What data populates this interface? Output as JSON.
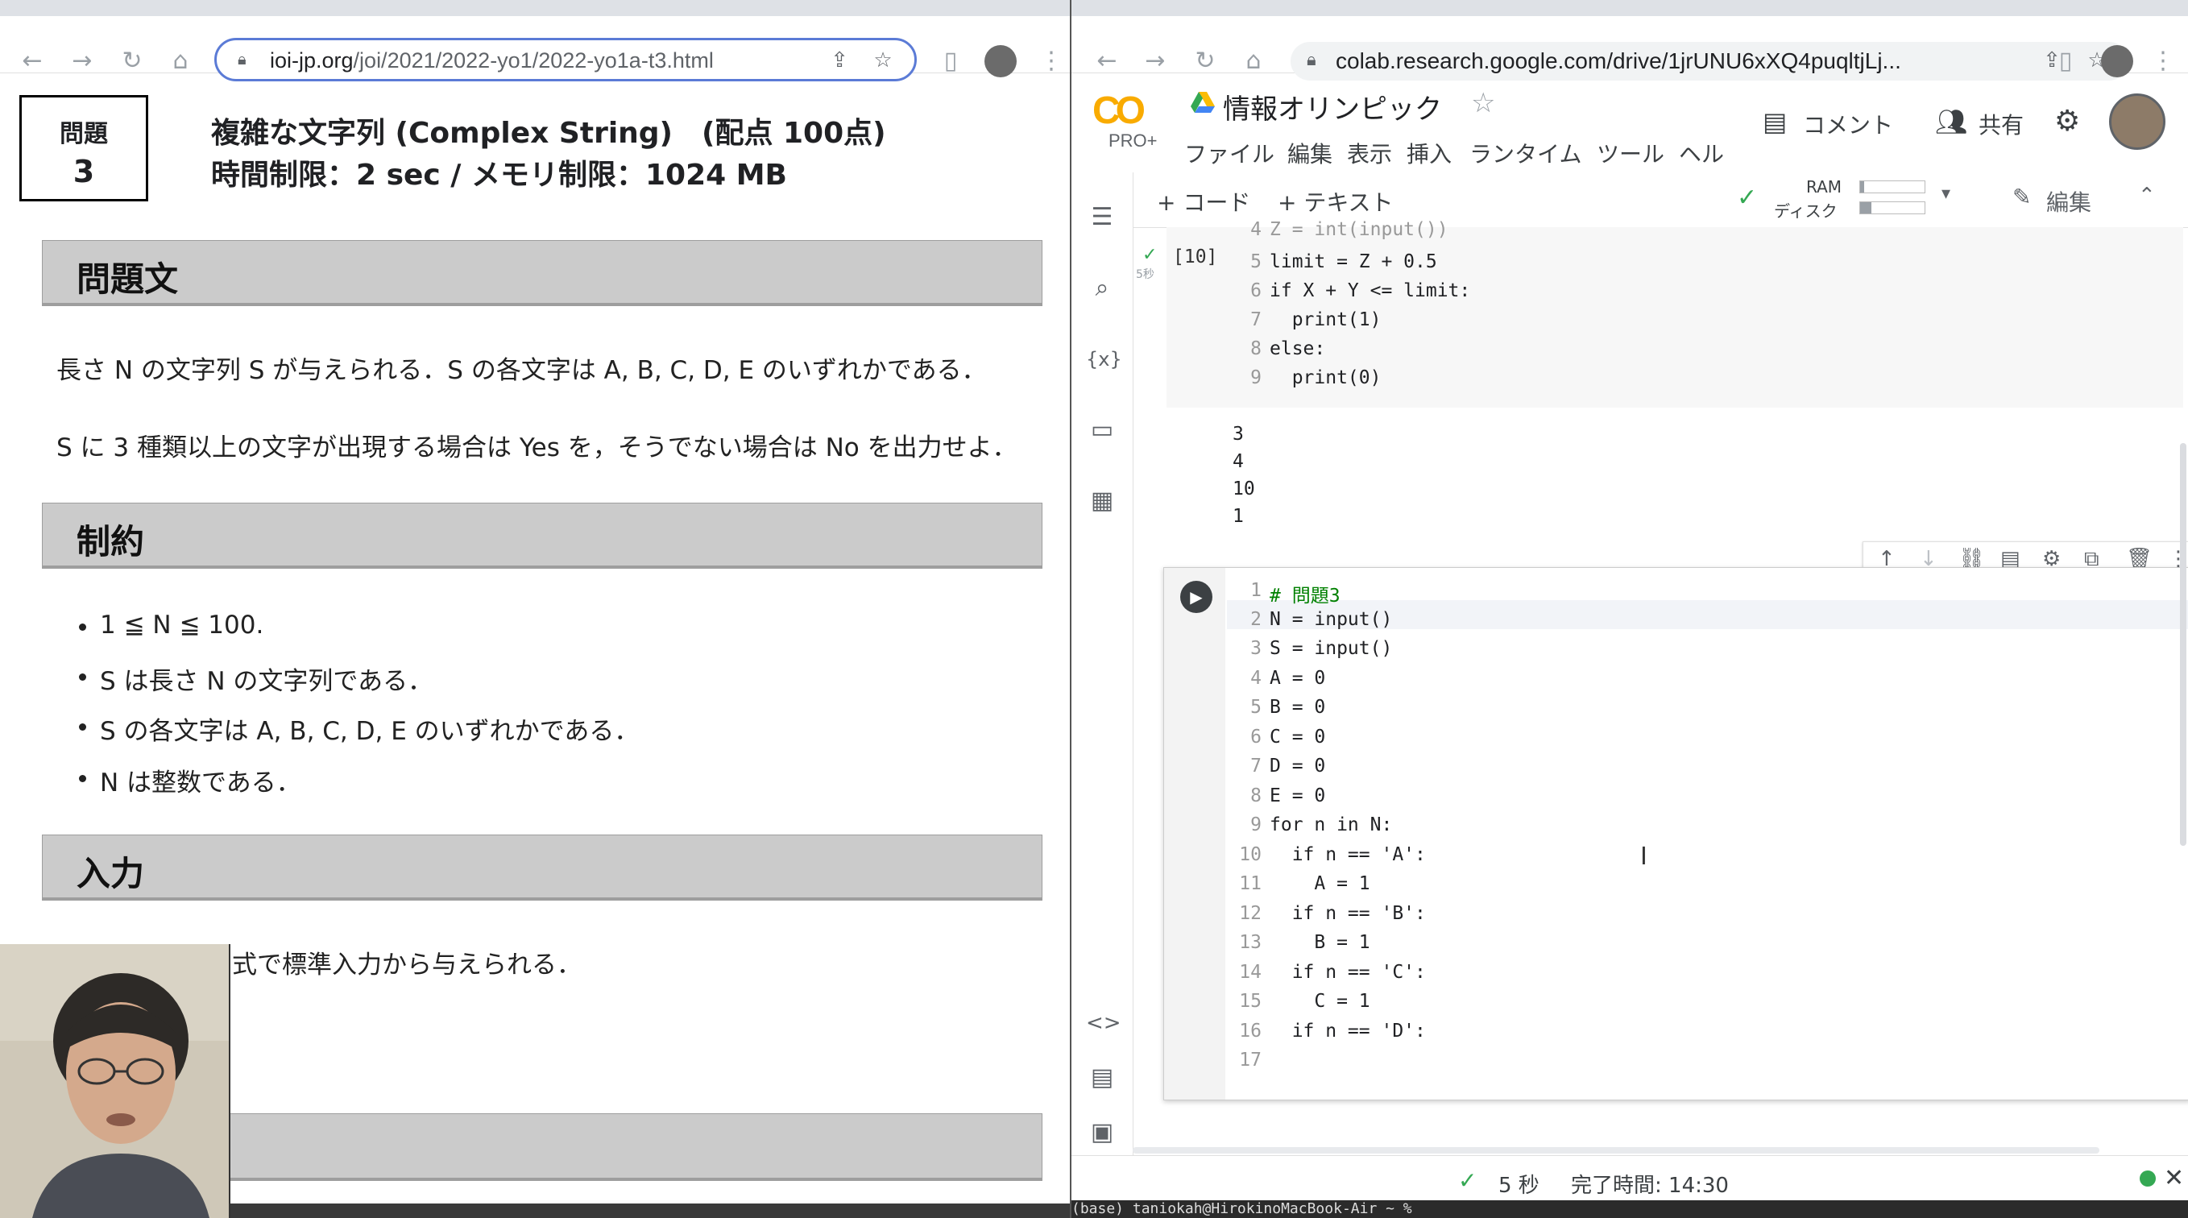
{
  "left_browser": {
    "url_host": "ioi-jp.org",
    "url_path": "/joi/2021/2022-yo1/2022-yo1a-t3.html",
    "problem_label": "問題",
    "problem_number": "3",
    "title": "複雑な文字列 (Complex String)　(配点 100点)",
    "limits": "時間制限：2 sec / メモリ制限：1024 MB",
    "sections": {
      "statement": "問題文",
      "constraints": "制約",
      "input": "入力"
    },
    "statement_lines": [
      "長さ N の文字列 S が与えられる．S の各文字は A, B, C, D, E のいずれかである．",
      "S に 3 種類以上の文字が出現する場合は Yes を，そうでない場合は No を出力せよ．"
    ],
    "constraints": [
      "1 ≦ N ≦ 100.",
      "S は長さ N の文字列である．",
      "S の各文字は A, B, C, D, E のいずれかである．",
      "N は整数である．"
    ],
    "input_text": "式で標準入力から与えられる．"
  },
  "right_browser": {
    "url": "colab.research.google.com/drive/1jrUNU6xXQ4puqltjLj...",
    "logo": "CO",
    "logo_badge": "PRO+",
    "notebook_title": "情報オリンピック",
    "menu": [
      "ファイル",
      "編集",
      "表示",
      "挿入",
      "ランタイム",
      "ツール",
      "ヘル"
    ],
    "header_buttons": {
      "comment": "コメント",
      "share": "共有"
    },
    "toolbar": {
      "add_code": "+ コード",
      "add_text": "+ テキスト",
      "ram": "RAM",
      "disk": "ディスク",
      "edit": "編集"
    },
    "prev_cell": {
      "exec_count": "[10]",
      "exec_time": "5秒",
      "lines": [
        {
          "n": "4",
          "code": "Z = int(input())"
        },
        {
          "n": "5",
          "code": "limit = Z + 0.5"
        },
        {
          "n": "6",
          "code": "if X + Y <= limit:"
        },
        {
          "n": "7",
          "code": "  print(1)"
        },
        {
          "n": "8",
          "code": "else:"
        },
        {
          "n": "9",
          "code": "  print(0)"
        }
      ],
      "output": [
        "3",
        "4",
        "10",
        "1"
      ]
    },
    "active_cell": {
      "lines": [
        {
          "n": "1",
          "code": "# 問題3"
        },
        {
          "n": "2",
          "code": "N = input()"
        },
        {
          "n": "3",
          "code": "S = input()"
        },
        {
          "n": "4",
          "code": "A = 0"
        },
        {
          "n": "5",
          "code": "B = 0"
        },
        {
          "n": "6",
          "code": "C = 0"
        },
        {
          "n": "7",
          "code": "D = 0"
        },
        {
          "n": "8",
          "code": "E = 0"
        },
        {
          "n": "9",
          "code": "for n in N:"
        },
        {
          "n": "10",
          "code": "  if n == 'A':"
        },
        {
          "n": "11",
          "code": "    A = 1"
        },
        {
          "n": "12",
          "code": "  if n == 'B':"
        },
        {
          "n": "13",
          "code": "    B = 1"
        },
        {
          "n": "14",
          "code": "  if n == 'C':"
        },
        {
          "n": "15",
          "code": "    C = 1"
        },
        {
          "n": "16",
          "code": "  if n == 'D':"
        },
        {
          "n": "17",
          "code": ""
        }
      ]
    },
    "status": {
      "check": "5 秒",
      "completed": "完了時間: 14:30"
    },
    "terminal": "(base) taniokah@HirokinoMacBook-Air ~ % "
  },
  "colors": {
    "accent_blue": "#5b7bd6",
    "colab_orange": "#f9ab00",
    "section_gray": "#cbcbcb",
    "status_green": "#34a853"
  }
}
